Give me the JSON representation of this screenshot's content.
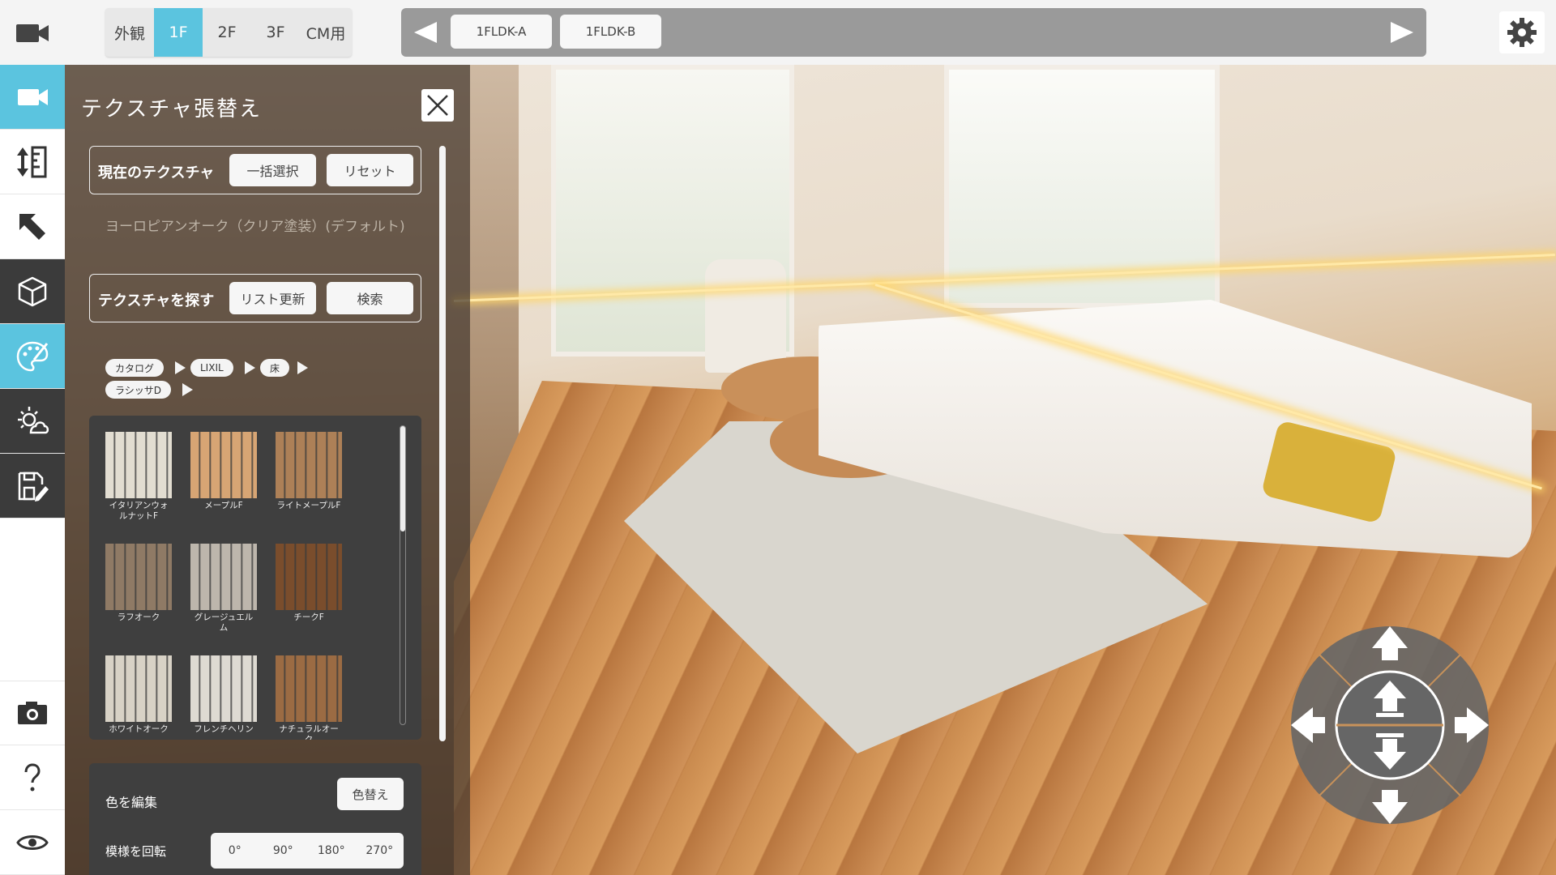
{
  "floor_tabs": [
    {
      "label": "外観",
      "active": false
    },
    {
      "label": "1F",
      "active": true
    },
    {
      "label": "2F",
      "active": false
    },
    {
      "label": "3F",
      "active": false
    },
    {
      "label": "CM用",
      "active": false
    }
  ],
  "plans": [
    "1FLDK-A",
    "1FLDK-B"
  ],
  "toolbar": {
    "items": [
      "camera-icon",
      "height-ruler-icon",
      "cursor-icon",
      "cube-icon",
      "palette-icon",
      "sun-weather-icon",
      "save-edit-icon"
    ],
    "bottom": [
      "screenshot-camera-icon",
      "help-icon",
      "eye-icon"
    ]
  },
  "panel": {
    "title": "テクスチャ張替え",
    "current": {
      "label": "現在のテクスチャ",
      "btn1": "一括選択",
      "btn2": "リセット",
      "name": "ヨーロピアンオーク（クリア塗装）(デフォルト)"
    },
    "search": {
      "label": "テクスチャを探す",
      "btn1": "リスト更新",
      "btn2": "検索"
    },
    "breadcrumb": [
      "カタログ",
      "LIXIL",
      "床",
      "ラシッサD"
    ],
    "textures": [
      {
        "name": "イタリアンウォルナットF",
        "color": "#e2ddd1"
      },
      {
        "name": "メープルF",
        "color": "#d7a574"
      },
      {
        "name": "ライトメープルF",
        "color": "#ad8057"
      },
      {
        "name": "ラフオーク",
        "color": "#8f7a65"
      },
      {
        "name": "グレージュエルム",
        "color": "#bdb6ac"
      },
      {
        "name": "チークF",
        "color": "#7a4d2c"
      },
      {
        "name": "ホワイトオーク",
        "color": "#d8d2c6"
      },
      {
        "name": "フレンチヘリン",
        "color": "#dedad2"
      },
      {
        "name": "ナチュラルオーク",
        "color": "#9b6b43"
      }
    ],
    "edit_color_label": "色を編集",
    "recolor_btn": "色替え",
    "rotate_label": "模様を回転",
    "rotate_options": [
      "0°",
      "90°",
      "180°",
      "270°"
    ]
  },
  "colors": {
    "accent": "#5bc4df",
    "toolbar_dark": "#3b3b3b",
    "panel_bg": "#3f3f3f"
  }
}
